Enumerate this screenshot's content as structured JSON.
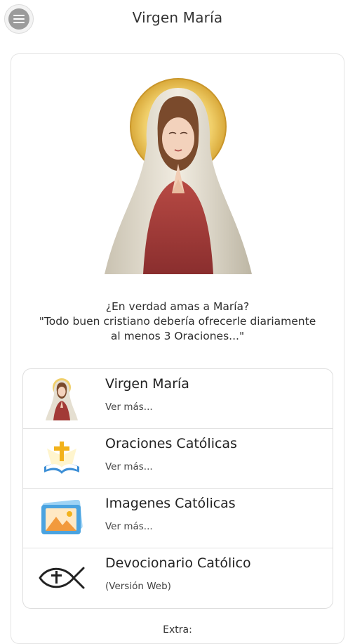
{
  "header": {
    "title": "Virgen María",
    "menu_icon": "hamburger-menu-icon"
  },
  "main": {
    "quote_lines": [
      "¿En verdad amas a María?",
      "\"Todo buen cristiano debería ofrecerle diariamente",
      "al menos 3 Oraciones...\""
    ],
    "items": [
      {
        "title": "Virgen María",
        "subtitle": "Ver más...",
        "icon": "virgin-mary-icon"
      },
      {
        "title": "Oraciones Católicas",
        "subtitle": "Ver más...",
        "icon": "bible-cross-icon"
      },
      {
        "title": "Imagenes Católicas",
        "subtitle": "Ver más...",
        "icon": "image-gallery-icon"
      },
      {
        "title": "Devocionario Católico",
        "subtitle": "(Versión Web)",
        "icon": "ichthys-fish-icon"
      }
    ],
    "extra_label": "Extra:"
  },
  "colors": {
    "halo": "#e7c25a",
    "veil": "#e9e5da",
    "robe": "#a23a36",
    "book_blue": "#3d8fd6",
    "cross_gold": "#f2b21b",
    "gallery_blue": "#4aa3e0",
    "gallery_orange": "#f29a3c"
  }
}
